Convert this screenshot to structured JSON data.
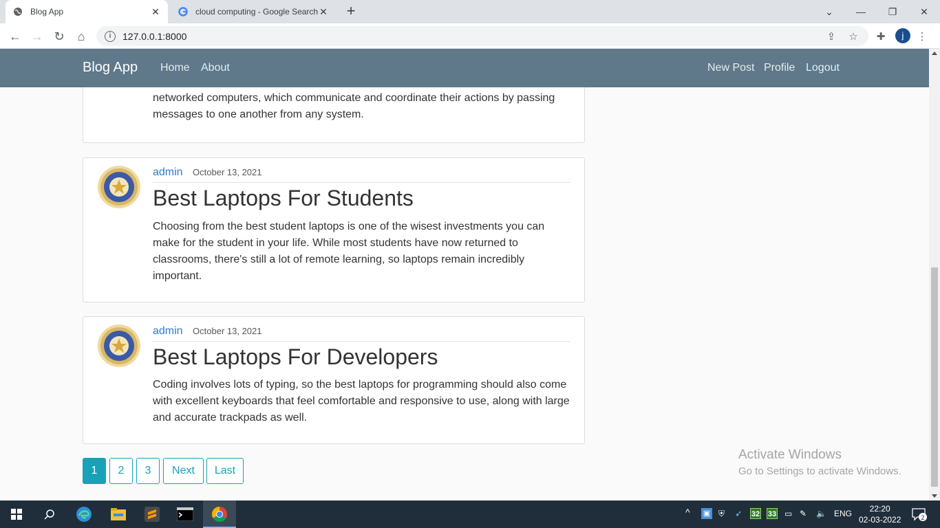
{
  "browser": {
    "tabs": [
      {
        "title": "Blog App",
        "active": true
      },
      {
        "title": "cloud computing - Google Search",
        "active": false
      }
    ],
    "url": "127.0.0.1:8000",
    "profile_initial": "j"
  },
  "site": {
    "brand": "Blog App",
    "nav_left": [
      "Home",
      "About"
    ],
    "nav_right": [
      "New Post",
      "Profile",
      "Logout"
    ]
  },
  "partial_post": {
    "body_visible": "networked computers, which communicate and coordinate their actions by passing messages to one another from any system."
  },
  "posts": [
    {
      "author": "admin",
      "date": "October 13, 2021",
      "title": "Best Laptops For Students",
      "body": "Choosing from the best student laptops is one of the wisest investments you can make for the student in your life. While most students have now returned to classrooms, there's still a lot of remote learning, so laptops remain incredibly important."
    },
    {
      "author": "admin",
      "date": "October 13, 2021",
      "title": "Best Laptops For Developers",
      "body": "Coding involves lots of typing, so the best laptops for programming should also come with excellent keyboards that feel comfortable and responsive to use, along with large and accurate trackpads as well."
    }
  ],
  "pagination": {
    "pages": [
      "1",
      "2",
      "3"
    ],
    "current": "1",
    "next": "Next",
    "last": "Last"
  },
  "watermark": {
    "line1": "Activate Windows",
    "line2": "Go to Settings to activate Windows."
  },
  "taskbar": {
    "tray_badges": [
      "32",
      "33"
    ],
    "language": "ENG",
    "time": "22:20",
    "date": "02-03-2022",
    "notifications": "2"
  },
  "colors": {
    "navbar": "#5f788a",
    "link": "#2c7bd1",
    "pager_accent": "#17a2b8",
    "taskbar": "#1f2e3a"
  }
}
